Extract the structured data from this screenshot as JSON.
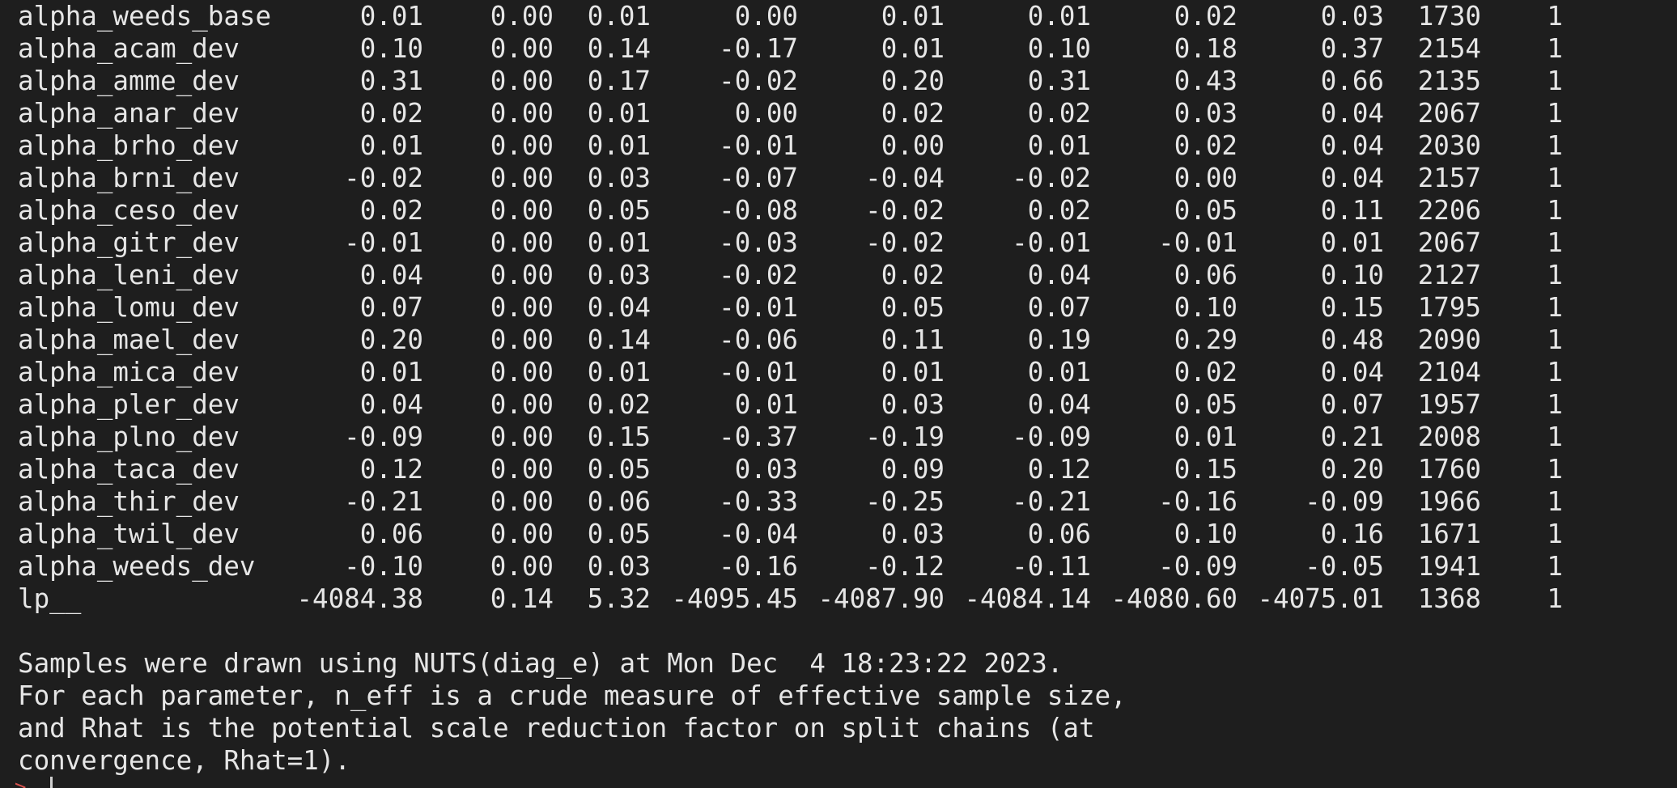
{
  "rows": [
    {
      "param": "alpha_weeds_base",
      "mean": "0.01",
      "se_mean": "0.00",
      "sd": "0.01",
      "q2_5": "0.00",
      "q25": "0.01",
      "q50": "0.01",
      "q75": "0.02",
      "q97_5": "0.03",
      "n_eff": "1730",
      "rhat": "1"
    },
    {
      "param": "alpha_acam_dev",
      "mean": "0.10",
      "se_mean": "0.00",
      "sd": "0.14",
      "q2_5": "-0.17",
      "q25": "0.01",
      "q50": "0.10",
      "q75": "0.18",
      "q97_5": "0.37",
      "n_eff": "2154",
      "rhat": "1"
    },
    {
      "param": "alpha_amme_dev",
      "mean": "0.31",
      "se_mean": "0.00",
      "sd": "0.17",
      "q2_5": "-0.02",
      "q25": "0.20",
      "q50": "0.31",
      "q75": "0.43",
      "q97_5": "0.66",
      "n_eff": "2135",
      "rhat": "1"
    },
    {
      "param": "alpha_anar_dev",
      "mean": "0.02",
      "se_mean": "0.00",
      "sd": "0.01",
      "q2_5": "0.00",
      "q25": "0.02",
      "q50": "0.02",
      "q75": "0.03",
      "q97_5": "0.04",
      "n_eff": "2067",
      "rhat": "1"
    },
    {
      "param": "alpha_brho_dev",
      "mean": "0.01",
      "se_mean": "0.00",
      "sd": "0.01",
      "q2_5": "-0.01",
      "q25": "0.00",
      "q50": "0.01",
      "q75": "0.02",
      "q97_5": "0.04",
      "n_eff": "2030",
      "rhat": "1"
    },
    {
      "param": "alpha_brni_dev",
      "mean": "-0.02",
      "se_mean": "0.00",
      "sd": "0.03",
      "q2_5": "-0.07",
      "q25": "-0.04",
      "q50": "-0.02",
      "q75": "0.00",
      "q97_5": "0.04",
      "n_eff": "2157",
      "rhat": "1"
    },
    {
      "param": "alpha_ceso_dev",
      "mean": "0.02",
      "se_mean": "0.00",
      "sd": "0.05",
      "q2_5": "-0.08",
      "q25": "-0.02",
      "q50": "0.02",
      "q75": "0.05",
      "q97_5": "0.11",
      "n_eff": "2206",
      "rhat": "1"
    },
    {
      "param": "alpha_gitr_dev",
      "mean": "-0.01",
      "se_mean": "0.00",
      "sd": "0.01",
      "q2_5": "-0.03",
      "q25": "-0.02",
      "q50": "-0.01",
      "q75": "-0.01",
      "q97_5": "0.01",
      "n_eff": "2067",
      "rhat": "1"
    },
    {
      "param": "alpha_leni_dev",
      "mean": "0.04",
      "se_mean": "0.00",
      "sd": "0.03",
      "q2_5": "-0.02",
      "q25": "0.02",
      "q50": "0.04",
      "q75": "0.06",
      "q97_5": "0.10",
      "n_eff": "2127",
      "rhat": "1"
    },
    {
      "param": "alpha_lomu_dev",
      "mean": "0.07",
      "se_mean": "0.00",
      "sd": "0.04",
      "q2_5": "-0.01",
      "q25": "0.05",
      "q50": "0.07",
      "q75": "0.10",
      "q97_5": "0.15",
      "n_eff": "1795",
      "rhat": "1"
    },
    {
      "param": "alpha_mael_dev",
      "mean": "0.20",
      "se_mean": "0.00",
      "sd": "0.14",
      "q2_5": "-0.06",
      "q25": "0.11",
      "q50": "0.19",
      "q75": "0.29",
      "q97_5": "0.48",
      "n_eff": "2090",
      "rhat": "1"
    },
    {
      "param": "alpha_mica_dev",
      "mean": "0.01",
      "se_mean": "0.00",
      "sd": "0.01",
      "q2_5": "-0.01",
      "q25": "0.01",
      "q50": "0.01",
      "q75": "0.02",
      "q97_5": "0.04",
      "n_eff": "2104",
      "rhat": "1"
    },
    {
      "param": "alpha_pler_dev",
      "mean": "0.04",
      "se_mean": "0.00",
      "sd": "0.02",
      "q2_5": "0.01",
      "q25": "0.03",
      "q50": "0.04",
      "q75": "0.05",
      "q97_5": "0.07",
      "n_eff": "1957",
      "rhat": "1"
    },
    {
      "param": "alpha_plno_dev",
      "mean": "-0.09",
      "se_mean": "0.00",
      "sd": "0.15",
      "q2_5": "-0.37",
      "q25": "-0.19",
      "q50": "-0.09",
      "q75": "0.01",
      "q97_5": "0.21",
      "n_eff": "2008",
      "rhat": "1"
    },
    {
      "param": "alpha_taca_dev",
      "mean": "0.12",
      "se_mean": "0.00",
      "sd": "0.05",
      "q2_5": "0.03",
      "q25": "0.09",
      "q50": "0.12",
      "q75": "0.15",
      "q97_5": "0.20",
      "n_eff": "1760",
      "rhat": "1"
    },
    {
      "param": "alpha_thir_dev",
      "mean": "-0.21",
      "se_mean": "0.00",
      "sd": "0.06",
      "q2_5": "-0.33",
      "q25": "-0.25",
      "q50": "-0.21",
      "q75": "-0.16",
      "q97_5": "-0.09",
      "n_eff": "1966",
      "rhat": "1"
    },
    {
      "param": "alpha_twil_dev",
      "mean": "0.06",
      "se_mean": "0.00",
      "sd": "0.05",
      "q2_5": "-0.04",
      "q25": "0.03",
      "q50": "0.06",
      "q75": "0.10",
      "q97_5": "0.16",
      "n_eff": "1671",
      "rhat": "1"
    },
    {
      "param": "alpha_weeds_dev",
      "mean": "-0.10",
      "se_mean": "0.00",
      "sd": "0.03",
      "q2_5": "-0.16",
      "q25": "-0.12",
      "q50": "-0.11",
      "q75": "-0.09",
      "q97_5": "-0.05",
      "n_eff": "1941",
      "rhat": "1"
    },
    {
      "param": "lp__",
      "mean": "-4084.38",
      "se_mean": "0.14",
      "sd": "5.32",
      "q2_5": "-4095.45",
      "q25": "-4087.90",
      "q50": "-4084.14",
      "q75": "-4080.60",
      "q97_5": "-4075.01",
      "n_eff": "1368",
      "rhat": "1"
    }
  ],
  "footer": {
    "line1": "Samples were drawn using NUTS(diag_e) at Mon Dec  4 18:23:22 2023.",
    "line2": "For each parameter, n_eff is a crude measure of effective sample size,",
    "line3": "and Rhat is the potential scale reduction factor on split chains (at",
    "line4": "convergence, Rhat=1)."
  },
  "prompt": {
    "glyph": ">"
  }
}
